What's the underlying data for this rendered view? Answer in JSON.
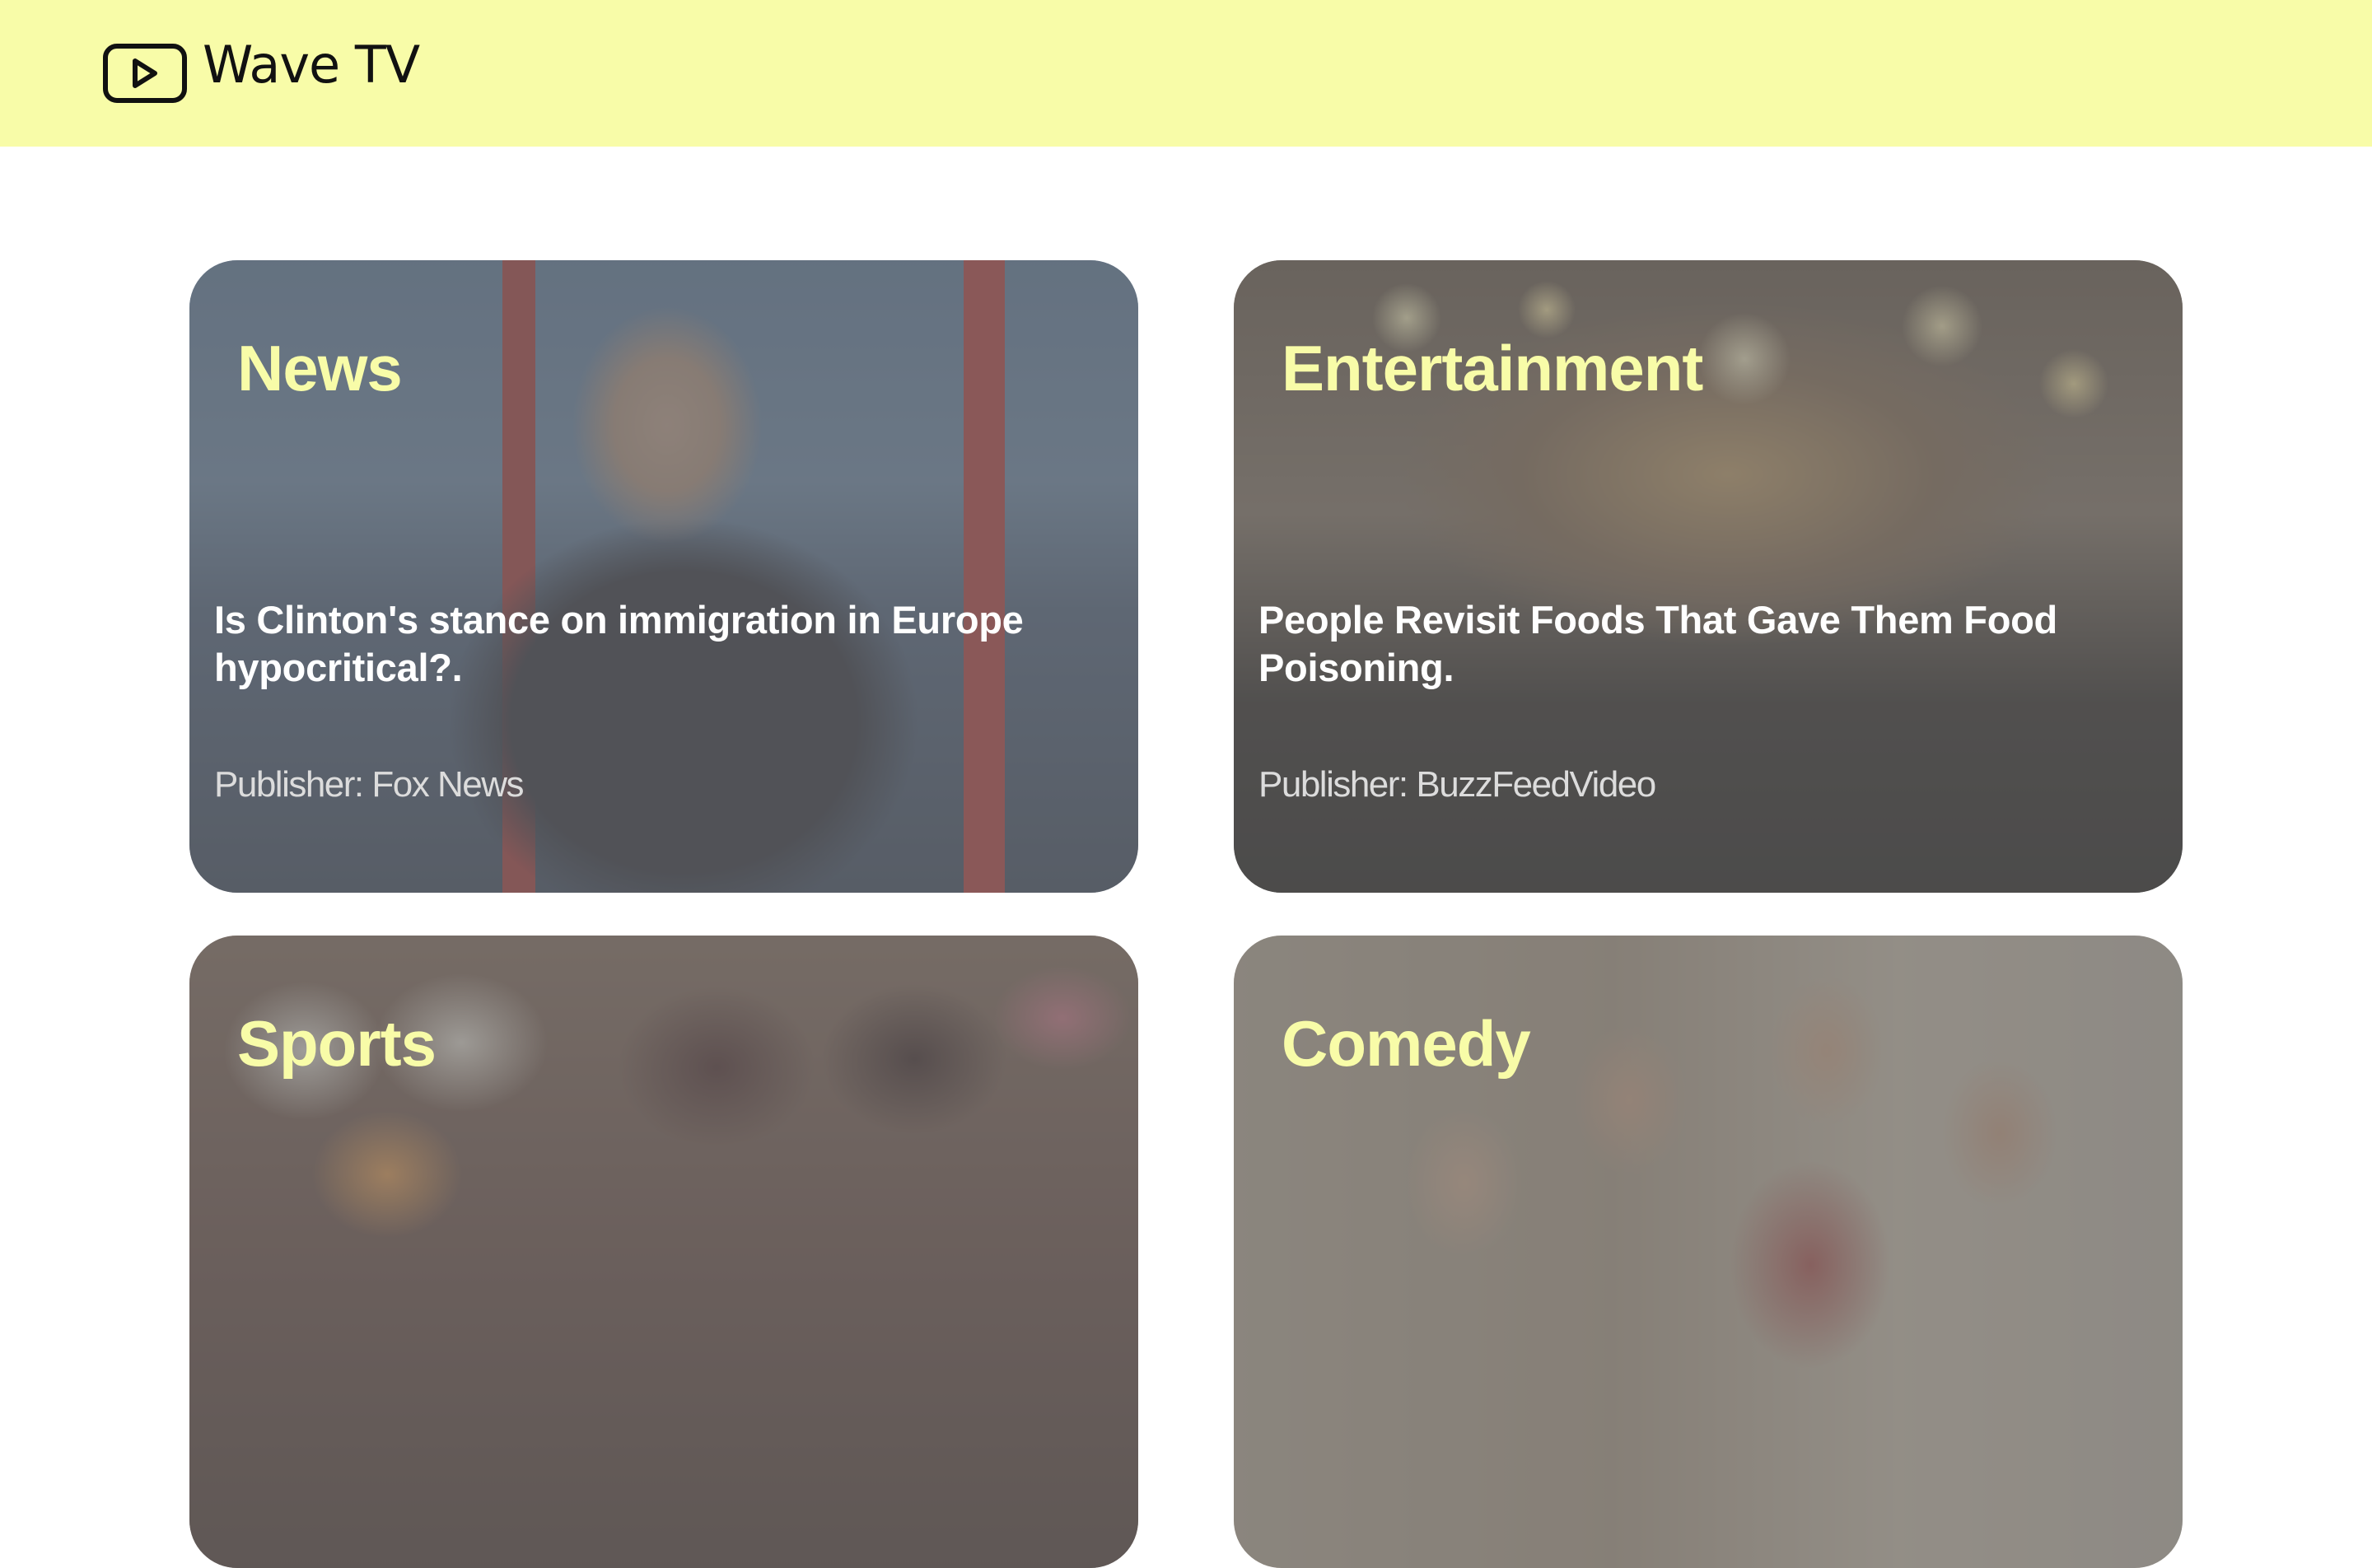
{
  "app": {
    "title": "Wave TV",
    "logo_icon": "play-box-icon",
    "accent_color": "#f8fca8"
  },
  "cards": [
    {
      "category": "News",
      "headline": "Is Clinton's stance on immigration in Europe hypocritical?.",
      "publisher": "Publisher: Fox News"
    },
    {
      "category": "Entertainment",
      "headline": "People Revisit Foods That Gave Them Food Poisoning.",
      "publisher": "Publisher: BuzzFeedVideo"
    },
    {
      "category": "Sports"
    },
    {
      "category": "Comedy"
    }
  ]
}
